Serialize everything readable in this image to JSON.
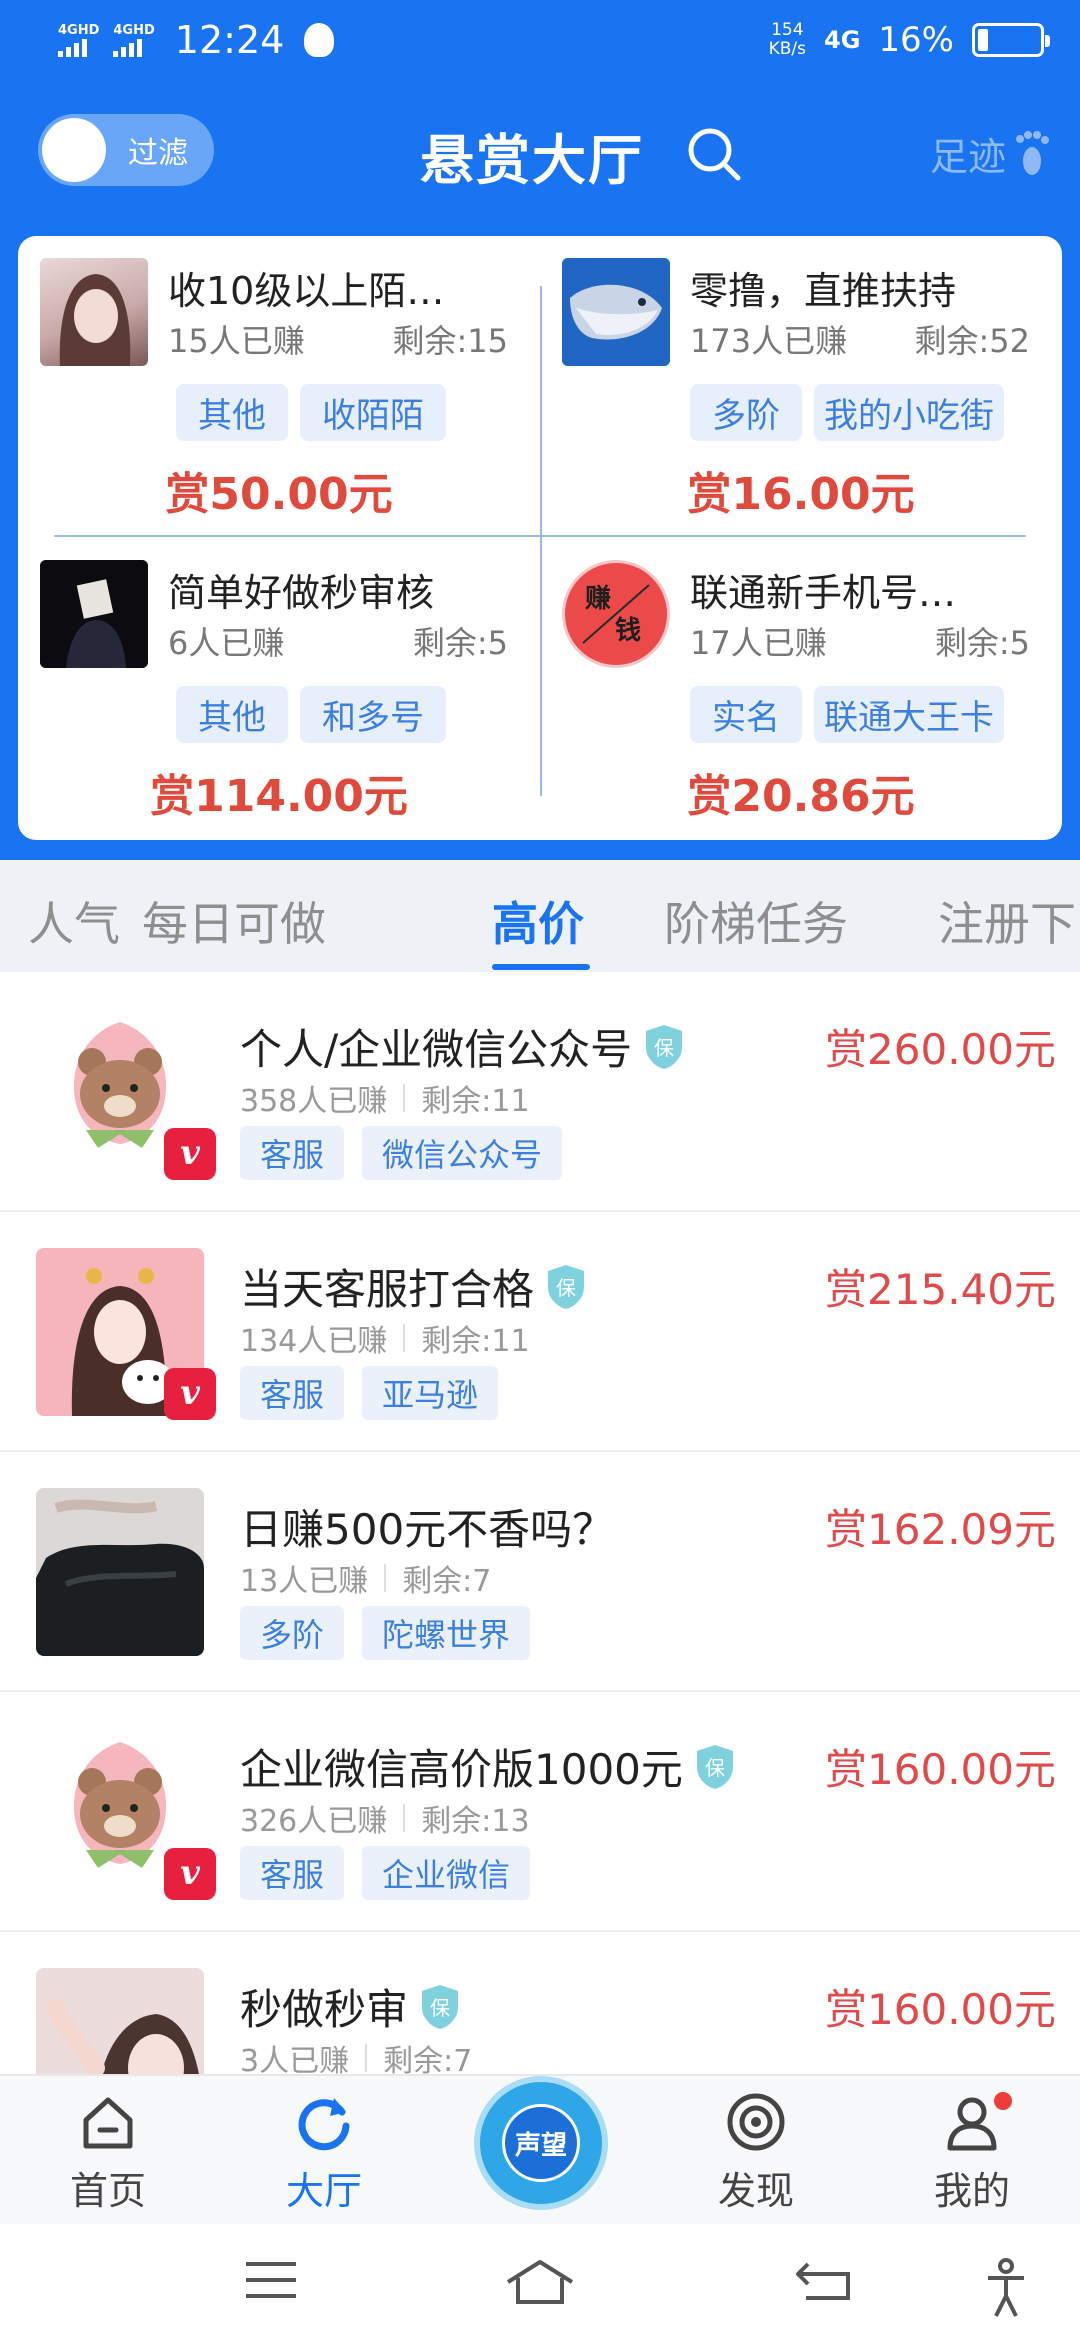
{
  "status_bar": {
    "signal1": "4GHD",
    "signal2": "4GHD",
    "time": "12:24",
    "speed_value": "154",
    "speed_unit": "KB/s",
    "network": "4G",
    "battery_percent": "16%",
    "battery_level": 0.16
  },
  "header": {
    "filter_label": "过滤",
    "title": "悬赏大厅",
    "footprint_label": "足迹"
  },
  "featured": [
    {
      "title": "收10级以上陌…",
      "earned": "15人已赚",
      "remaining": "剩余:15",
      "tags": [
        "其他",
        "收陌陌"
      ],
      "reward": "赏50.00元"
    },
    {
      "title": "零撸，直推扶持",
      "earned": "173人已赚",
      "remaining": "剩余:52",
      "tags": [
        "多阶",
        "我的小吃街"
      ],
      "reward": "赏16.00元"
    },
    {
      "title": "简单好做秒审核",
      "earned": "6人已赚",
      "remaining": "剩余:5",
      "tags": [
        "其他",
        "和多号"
      ],
      "reward": "赏114.00元"
    },
    {
      "title": "联通新手机号…",
      "earned": "17人已赚",
      "remaining": "剩余:5",
      "tags": [
        "实名",
        "联通大王卡"
      ],
      "reward": "赏20.86元",
      "avatar_text": [
        "赚",
        "钱"
      ]
    }
  ],
  "tabs": [
    "人气",
    "每日可做",
    "高价",
    "阶梯任务",
    "注册下"
  ],
  "active_tab": 2,
  "list": [
    {
      "title": "个人/企业微信公众号",
      "shield": "保",
      "earned": "358人已赚",
      "remaining": "剩余:11",
      "tags": [
        "客服",
        "微信公众号"
      ],
      "reward": "赏260.00元",
      "vip": "v"
    },
    {
      "title": "当天客服打合格",
      "shield": "保",
      "earned": "134人已赚",
      "remaining": "剩余:11",
      "tags": [
        "客服",
        "亚马逊"
      ],
      "reward": "赏215.40元",
      "vip": "v"
    },
    {
      "title": "日赚500元不香吗？",
      "shield": "",
      "earned": "13人已赚",
      "remaining": "剩余:7",
      "tags": [
        "多阶",
        "陀螺世界"
      ],
      "reward": "赏162.09元",
      "vip": ""
    },
    {
      "title": "企业微信高价版1000元",
      "shield": "保",
      "earned": "326人已赚",
      "remaining": "剩余:13",
      "tags": [
        "客服",
        "企业微信"
      ],
      "reward": "赏160.00元",
      "vip": "v"
    },
    {
      "title": "秒做秒审",
      "shield": "保",
      "earned": "3人已赚",
      "remaining": "剩余:7",
      "tags": [],
      "reward": "赏160.00元",
      "vip": ""
    }
  ],
  "bottom_nav": {
    "home": "首页",
    "hall": "大厅",
    "center": "声望",
    "discover": "发现",
    "mine": "我的"
  },
  "colors": {
    "primary": "#1a73f0",
    "reward": "#e04a3c",
    "tag_bg": "#e6effb",
    "tag_text": "#3d7fe0"
  }
}
